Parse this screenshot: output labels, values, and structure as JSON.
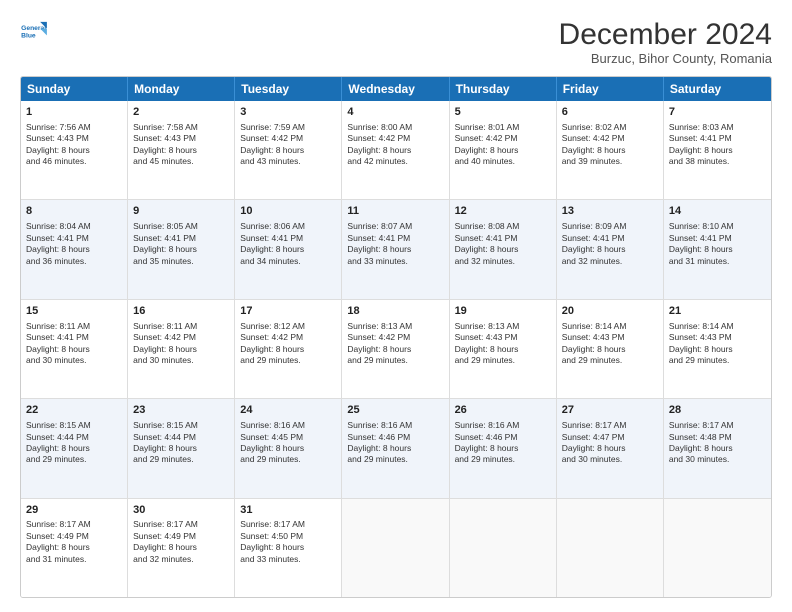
{
  "logo": {
    "line1": "General",
    "line2": "Blue"
  },
  "title": "December 2024",
  "subtitle": "Burzuc, Bihor County, Romania",
  "days": [
    "Sunday",
    "Monday",
    "Tuesday",
    "Wednesday",
    "Thursday",
    "Friday",
    "Saturday"
  ],
  "rows": [
    [
      {
        "day": "1",
        "lines": [
          "Sunrise: 7:56 AM",
          "Sunset: 4:43 PM",
          "Daylight: 8 hours",
          "and 46 minutes."
        ]
      },
      {
        "day": "2",
        "lines": [
          "Sunrise: 7:58 AM",
          "Sunset: 4:43 PM",
          "Daylight: 8 hours",
          "and 45 minutes."
        ]
      },
      {
        "day": "3",
        "lines": [
          "Sunrise: 7:59 AM",
          "Sunset: 4:42 PM",
          "Daylight: 8 hours",
          "and 43 minutes."
        ]
      },
      {
        "day": "4",
        "lines": [
          "Sunrise: 8:00 AM",
          "Sunset: 4:42 PM",
          "Daylight: 8 hours",
          "and 42 minutes."
        ]
      },
      {
        "day": "5",
        "lines": [
          "Sunrise: 8:01 AM",
          "Sunset: 4:42 PM",
          "Daylight: 8 hours",
          "and 40 minutes."
        ]
      },
      {
        "day": "6",
        "lines": [
          "Sunrise: 8:02 AM",
          "Sunset: 4:42 PM",
          "Daylight: 8 hours",
          "and 39 minutes."
        ]
      },
      {
        "day": "7",
        "lines": [
          "Sunrise: 8:03 AM",
          "Sunset: 4:41 PM",
          "Daylight: 8 hours",
          "and 38 minutes."
        ]
      }
    ],
    [
      {
        "day": "8",
        "lines": [
          "Sunrise: 8:04 AM",
          "Sunset: 4:41 PM",
          "Daylight: 8 hours",
          "and 36 minutes."
        ]
      },
      {
        "day": "9",
        "lines": [
          "Sunrise: 8:05 AM",
          "Sunset: 4:41 PM",
          "Daylight: 8 hours",
          "and 35 minutes."
        ]
      },
      {
        "day": "10",
        "lines": [
          "Sunrise: 8:06 AM",
          "Sunset: 4:41 PM",
          "Daylight: 8 hours",
          "and 34 minutes."
        ]
      },
      {
        "day": "11",
        "lines": [
          "Sunrise: 8:07 AM",
          "Sunset: 4:41 PM",
          "Daylight: 8 hours",
          "and 33 minutes."
        ]
      },
      {
        "day": "12",
        "lines": [
          "Sunrise: 8:08 AM",
          "Sunset: 4:41 PM",
          "Daylight: 8 hours",
          "and 32 minutes."
        ]
      },
      {
        "day": "13",
        "lines": [
          "Sunrise: 8:09 AM",
          "Sunset: 4:41 PM",
          "Daylight: 8 hours",
          "and 32 minutes."
        ]
      },
      {
        "day": "14",
        "lines": [
          "Sunrise: 8:10 AM",
          "Sunset: 4:41 PM",
          "Daylight: 8 hours",
          "and 31 minutes."
        ]
      }
    ],
    [
      {
        "day": "15",
        "lines": [
          "Sunrise: 8:11 AM",
          "Sunset: 4:41 PM",
          "Daylight: 8 hours",
          "and 30 minutes."
        ]
      },
      {
        "day": "16",
        "lines": [
          "Sunrise: 8:11 AM",
          "Sunset: 4:42 PM",
          "Daylight: 8 hours",
          "and 30 minutes."
        ]
      },
      {
        "day": "17",
        "lines": [
          "Sunrise: 8:12 AM",
          "Sunset: 4:42 PM",
          "Daylight: 8 hours",
          "and 29 minutes."
        ]
      },
      {
        "day": "18",
        "lines": [
          "Sunrise: 8:13 AM",
          "Sunset: 4:42 PM",
          "Daylight: 8 hours",
          "and 29 minutes."
        ]
      },
      {
        "day": "19",
        "lines": [
          "Sunrise: 8:13 AM",
          "Sunset: 4:43 PM",
          "Daylight: 8 hours",
          "and 29 minutes."
        ]
      },
      {
        "day": "20",
        "lines": [
          "Sunrise: 8:14 AM",
          "Sunset: 4:43 PM",
          "Daylight: 8 hours",
          "and 29 minutes."
        ]
      },
      {
        "day": "21",
        "lines": [
          "Sunrise: 8:14 AM",
          "Sunset: 4:43 PM",
          "Daylight: 8 hours",
          "and 29 minutes."
        ]
      }
    ],
    [
      {
        "day": "22",
        "lines": [
          "Sunrise: 8:15 AM",
          "Sunset: 4:44 PM",
          "Daylight: 8 hours",
          "and 29 minutes."
        ]
      },
      {
        "day": "23",
        "lines": [
          "Sunrise: 8:15 AM",
          "Sunset: 4:44 PM",
          "Daylight: 8 hours",
          "and 29 minutes."
        ]
      },
      {
        "day": "24",
        "lines": [
          "Sunrise: 8:16 AM",
          "Sunset: 4:45 PM",
          "Daylight: 8 hours",
          "and 29 minutes."
        ]
      },
      {
        "day": "25",
        "lines": [
          "Sunrise: 8:16 AM",
          "Sunset: 4:46 PM",
          "Daylight: 8 hours",
          "and 29 minutes."
        ]
      },
      {
        "day": "26",
        "lines": [
          "Sunrise: 8:16 AM",
          "Sunset: 4:46 PM",
          "Daylight: 8 hours",
          "and 29 minutes."
        ]
      },
      {
        "day": "27",
        "lines": [
          "Sunrise: 8:17 AM",
          "Sunset: 4:47 PM",
          "Daylight: 8 hours",
          "and 30 minutes."
        ]
      },
      {
        "day": "28",
        "lines": [
          "Sunrise: 8:17 AM",
          "Sunset: 4:48 PM",
          "Daylight: 8 hours",
          "and 30 minutes."
        ]
      }
    ],
    [
      {
        "day": "29",
        "lines": [
          "Sunrise: 8:17 AM",
          "Sunset: 4:49 PM",
          "Daylight: 8 hours",
          "and 31 minutes."
        ]
      },
      {
        "day": "30",
        "lines": [
          "Sunrise: 8:17 AM",
          "Sunset: 4:49 PM",
          "Daylight: 8 hours",
          "and 32 minutes."
        ]
      },
      {
        "day": "31",
        "lines": [
          "Sunrise: 8:17 AM",
          "Sunset: 4:50 PM",
          "Daylight: 8 hours",
          "and 33 minutes."
        ]
      },
      {
        "day": "",
        "lines": []
      },
      {
        "day": "",
        "lines": []
      },
      {
        "day": "",
        "lines": []
      },
      {
        "day": "",
        "lines": []
      }
    ]
  ]
}
